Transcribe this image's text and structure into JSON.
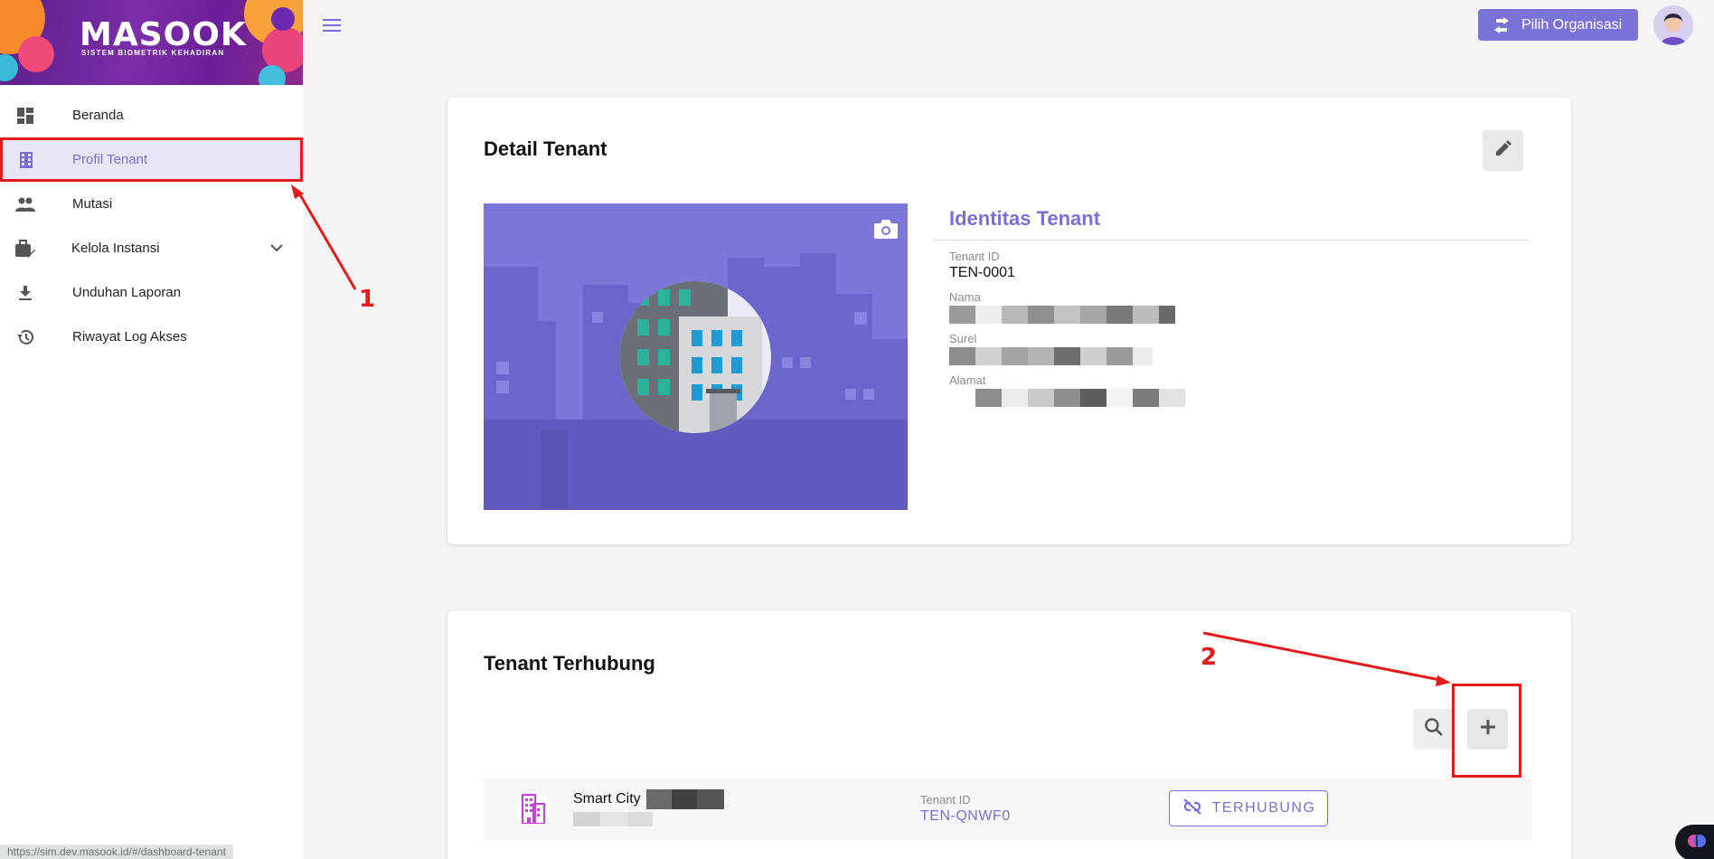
{
  "brand": {
    "name": "MASOOK",
    "tagline": "SISTEM BIOMETRIK KEHADIRAN"
  },
  "sidebar": {
    "items": [
      {
        "label": "Beranda",
        "icon": "dashboard-icon"
      },
      {
        "label": "Profil Tenant",
        "icon": "building-icon",
        "active": true
      },
      {
        "label": "Mutasi",
        "icon": "people-icon"
      },
      {
        "label": "Kelola Instansi",
        "icon": "briefcase-edit-icon",
        "expandable": true
      },
      {
        "label": "Unduhan Laporan",
        "icon": "download-icon"
      },
      {
        "label": "Riwayat Log Akses",
        "icon": "history-icon"
      }
    ]
  },
  "status_url": "https://sim.dev.masook.id/#/dashboard-tenant",
  "topbar": {
    "org_button": "Pilih Organisasi"
  },
  "detail": {
    "title": "Detail Tenant",
    "identity_title": "Identitas Tenant",
    "fields": [
      {
        "label": "Tenant ID",
        "value": "TEN-0001"
      },
      {
        "label": "Nama",
        "value": ""
      },
      {
        "label": "Surel",
        "value": ""
      },
      {
        "label": "Alamat",
        "value": ""
      }
    ]
  },
  "linked": {
    "title": "Tenant Terhubung",
    "rows": [
      {
        "name": "Smart City",
        "tid_label": "Tenant ID",
        "tid": "TEN-QNWF0",
        "status": "TERHUBUNG"
      }
    ]
  },
  "annotations": {
    "one": "1",
    "two": "2"
  },
  "colors": {
    "accent": "#7a6fd6",
    "annotation": "#e31b1b",
    "image_bg": "#7d76d9"
  }
}
